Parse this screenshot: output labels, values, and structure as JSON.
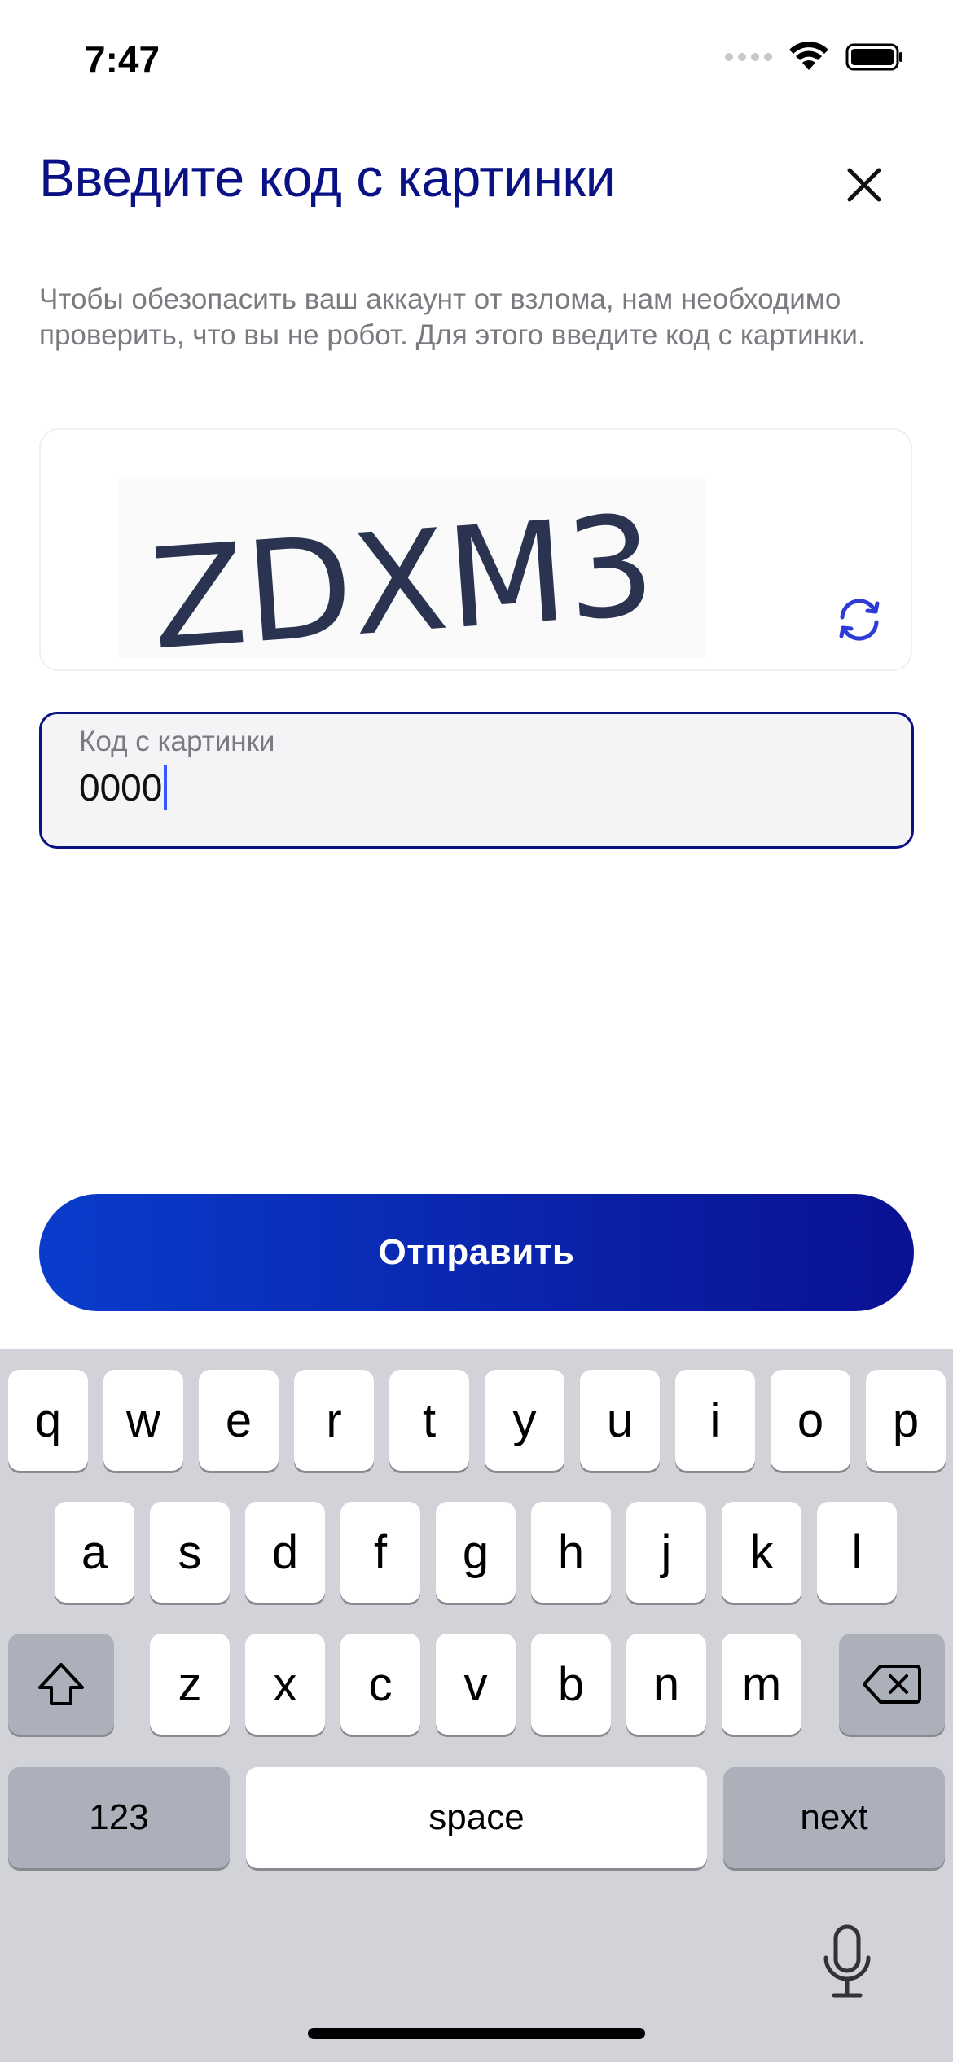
{
  "status": {
    "time": "7:47",
    "icons": [
      "signal-icon",
      "wifi-icon",
      "battery-icon"
    ]
  },
  "header": {
    "title": "Введите код с картинки",
    "close_icon": "close-icon"
  },
  "description": "Чтобы обезопасить ваш аккаунт от взлома, нам необходимо проверить, что вы не робот. Для этого введите код с картинки.",
  "captcha": {
    "text": "ZDXM3",
    "refresh_icon": "refresh-icon"
  },
  "code_field": {
    "label": "Код с картинки",
    "value": "0000"
  },
  "submit_label": "Отправить",
  "keyboard": {
    "row1": [
      "q",
      "w",
      "e",
      "r",
      "t",
      "y",
      "u",
      "i",
      "o",
      "p"
    ],
    "row2": [
      "a",
      "s",
      "d",
      "f",
      "g",
      "h",
      "j",
      "k",
      "l"
    ],
    "row3": [
      "z",
      "x",
      "c",
      "v",
      "b",
      "n",
      "m"
    ],
    "numbers_label": "123",
    "space_label": "space",
    "next_label": "next"
  },
  "colors": {
    "accent": "#0a1184",
    "button_start": "#0a3ccc",
    "button_end": "#0a1192",
    "keyboard_bg": "#d1d3d9"
  }
}
